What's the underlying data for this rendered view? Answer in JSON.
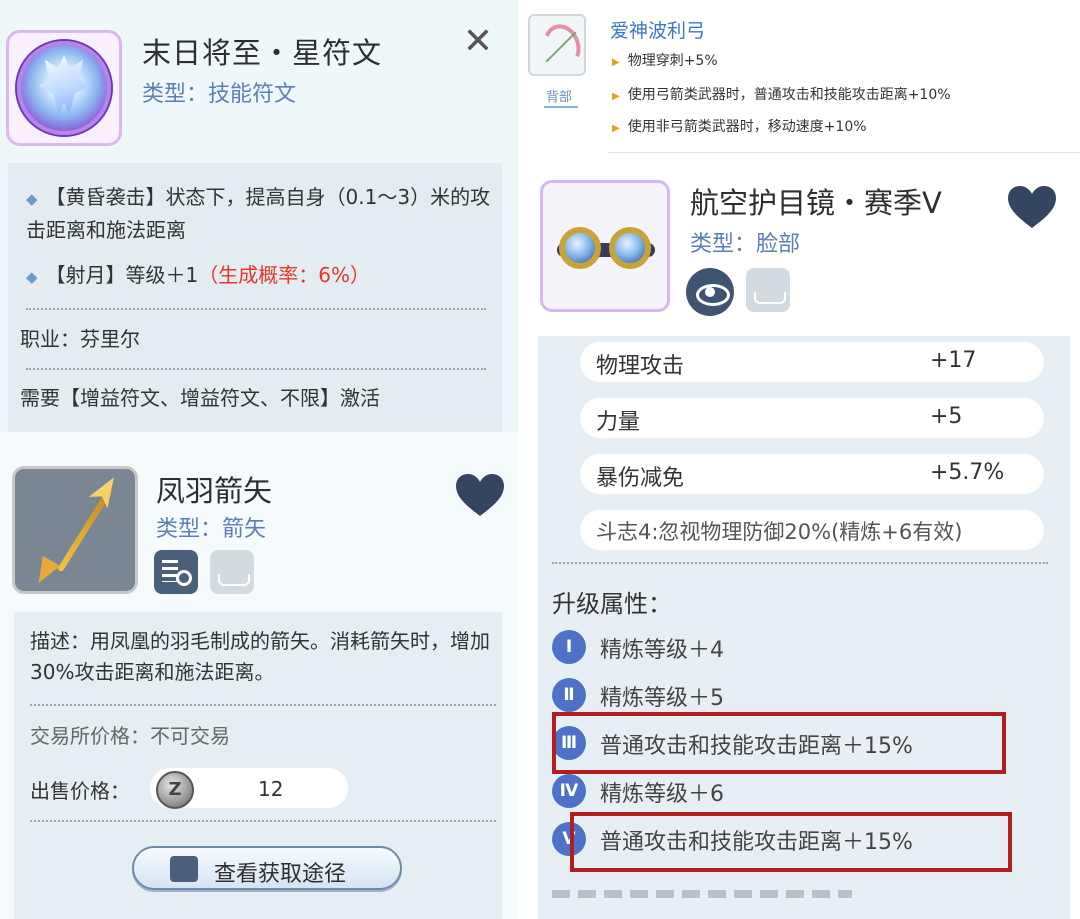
{
  "rune": {
    "title": "末日将至・星符文",
    "type": "类型：技能符文",
    "close": "✕",
    "effect1": "【黄昏袭击】状态下，提高自身（0.1～3）米的攻击距离和施法距离",
    "effect2_prefix": "【射月】等级＋1",
    "effect2_chance": "（生成概率：6%）",
    "job": "职业：芬里尔",
    "requirement": "需要【增益符文、增益符文、不限】激活"
  },
  "arrow": {
    "title": "凤羽箭矢",
    "type": "类型：箭矢",
    "description": "描述：用凤凰的羽毛制成的箭矢。消耗箭矢时，增加30%攻击距离和施法距离。",
    "trade": "交易所价格：不可交易",
    "sell_label": "出售价格：",
    "sell_value": "12",
    "source_button": "查看获取途径"
  },
  "bow": {
    "name": "爱神波利弓",
    "slot": "背部",
    "lines": [
      "物理穿刺+5%",
      "使用弓箭类武器时，普通攻击和技能攻击距离+10%",
      "使用非弓箭类武器时，移动速度+10%"
    ]
  },
  "goggles": {
    "title": "航空护目镜・赛季V",
    "type": "类型：脸部",
    "stats": [
      {
        "name": "物理攻击",
        "value": "+17"
      },
      {
        "name": "力量",
        "value": "+5"
      },
      {
        "name": "暴伤减免",
        "value": "+5.7%"
      }
    ],
    "special": "斗志4:忽视物理防御20%(精炼+6有效)",
    "upgrade_title": "升级属性：",
    "upgrades": [
      {
        "num": "Ⅰ",
        "text": "精炼等级＋4"
      },
      {
        "num": "Ⅱ",
        "text": "精炼等级＋5"
      },
      {
        "num": "Ⅲ",
        "text": "普通攻击和技能攻击距离＋15%"
      },
      {
        "num": "Ⅳ",
        "text": "精炼等级＋6"
      },
      {
        "num": "Ⅴ",
        "text": "普通攻击和技能攻击距离＋15%"
      }
    ]
  },
  "colors": {
    "accent_blue": "#5a7fb5",
    "red_text": "#e5362b",
    "highlight_box": "#b01e1e",
    "heart": "#34455f"
  },
  "icons": [
    "close-icon",
    "heart-icon",
    "inspect-icon",
    "wardrobe-icon",
    "eye-icon",
    "coin-icon"
  ]
}
